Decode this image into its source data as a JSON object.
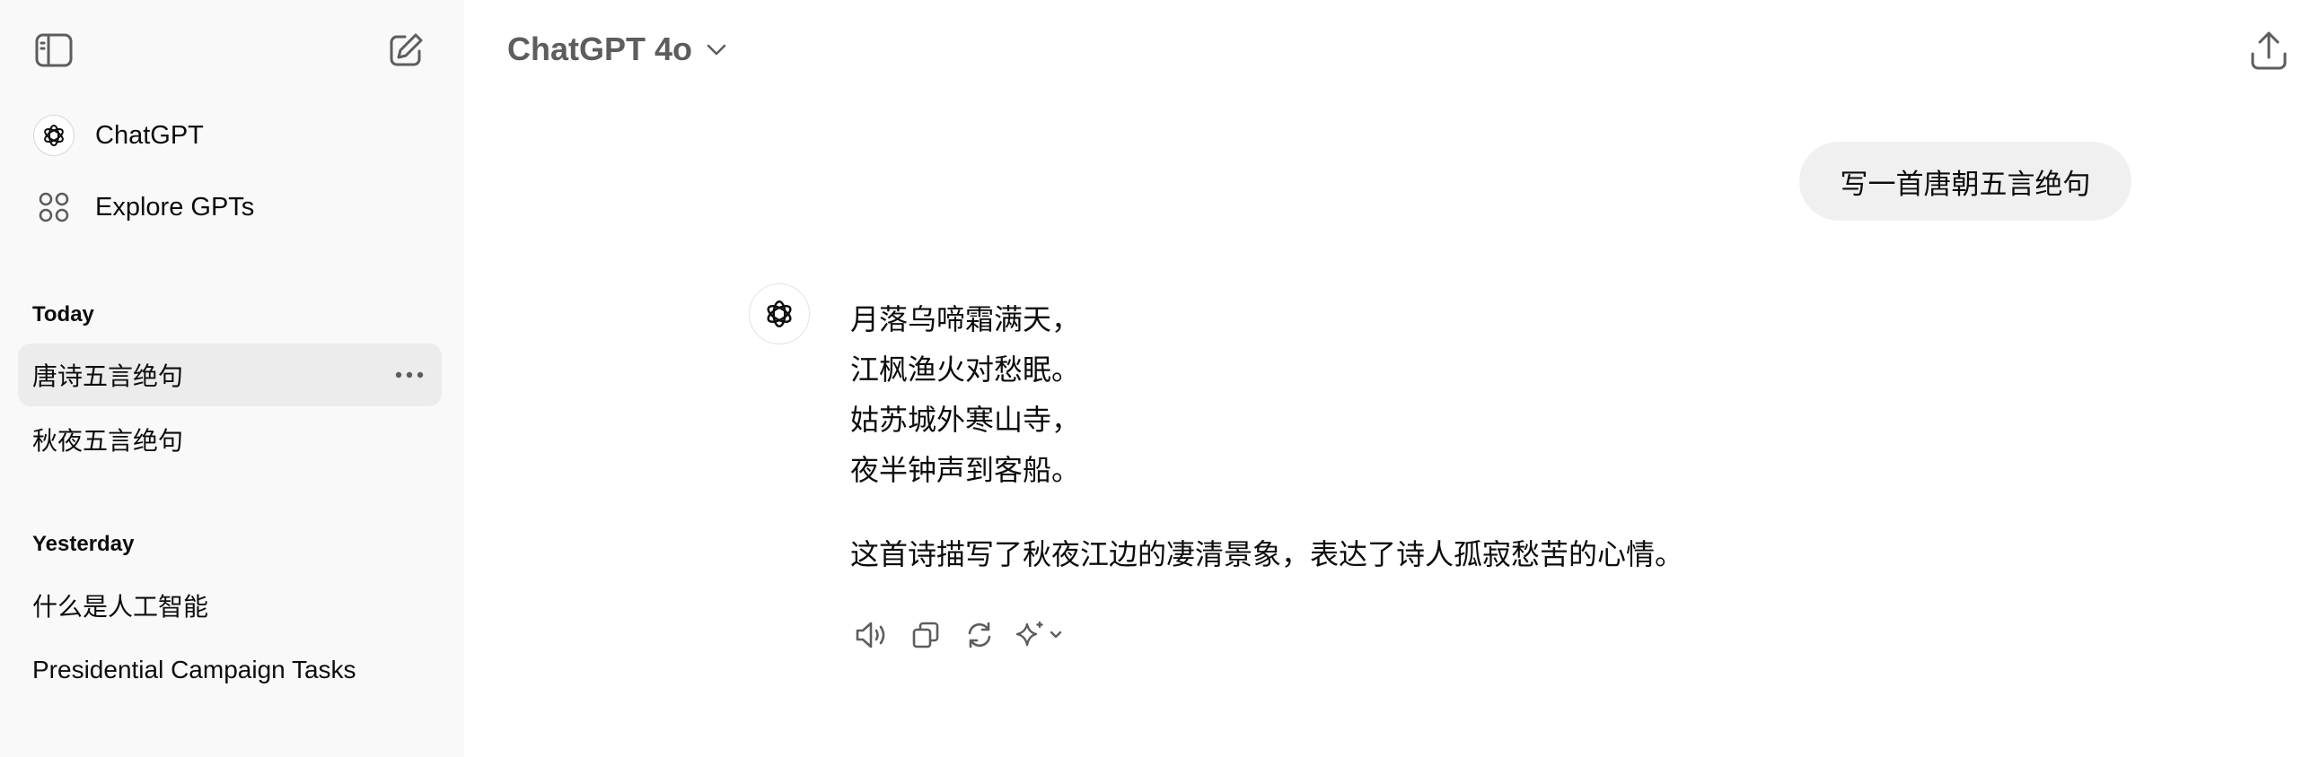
{
  "sidebar": {
    "nav": [
      {
        "label": "ChatGPT",
        "icon": "openai-logo-icon"
      },
      {
        "label": "Explore GPTs",
        "icon": "grid-icon"
      }
    ],
    "sections": [
      {
        "title": "Today",
        "items": [
          "唐诗五言绝句",
          "秋夜五言绝句"
        ],
        "active_index": 0
      },
      {
        "title": "Yesterday",
        "items": [
          "什么是人工智能",
          "Presidential Campaign Tasks"
        ]
      }
    ]
  },
  "header": {
    "model_label": "ChatGPT 4o"
  },
  "chat": {
    "user_message": "写一首唐朝五言绝句",
    "assistant_poem": [
      "月落乌啼霜满天，",
      "江枫渔火对愁眠。",
      "姑苏城外寒山寺，",
      "夜半钟声到客船。"
    ],
    "assistant_description": "这首诗描写了秋夜江边的凄清景象，表达了诗人孤寂愁苦的心情。",
    "actions": [
      "read-aloud-icon",
      "copy-icon",
      "regenerate-icon",
      "sparkle-model-icon"
    ]
  },
  "colors": {
    "sidebar_bg": "#f9f9f9",
    "active_item_bg": "#ececec",
    "user_bubble_bg": "#f0f0f0",
    "muted_text": "#5d5d5d"
  }
}
